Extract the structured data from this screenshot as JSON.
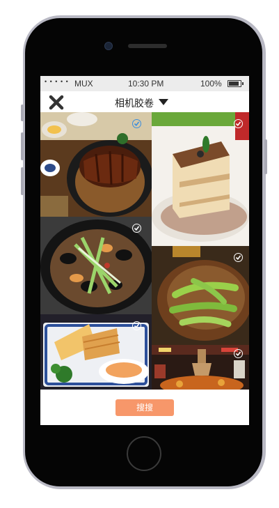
{
  "status_bar": {
    "signal_dots": "• • • • •",
    "carrier": "MUX",
    "time": "10:30 PM",
    "battery": "100%"
  },
  "nav": {
    "close_icon": "close-icon",
    "title": "相机胶卷",
    "dropdown_icon": "caret-down-icon"
  },
  "photos": [
    {
      "name": "unagi-rice",
      "selected": true
    },
    {
      "name": "tiramisu-cake",
      "selected": false
    },
    {
      "name": "mussels-pan",
      "selected": false
    },
    {
      "name": "bitter-melon-pot",
      "selected": false
    },
    {
      "name": "bread-plate",
      "selected": false
    },
    {
      "name": "hotpot-restaurant",
      "selected": false
    }
  ],
  "footer": {
    "search_button": "搜搜"
  },
  "colors": {
    "accent": "#f7976a",
    "selected_check": "#3a8dde"
  }
}
